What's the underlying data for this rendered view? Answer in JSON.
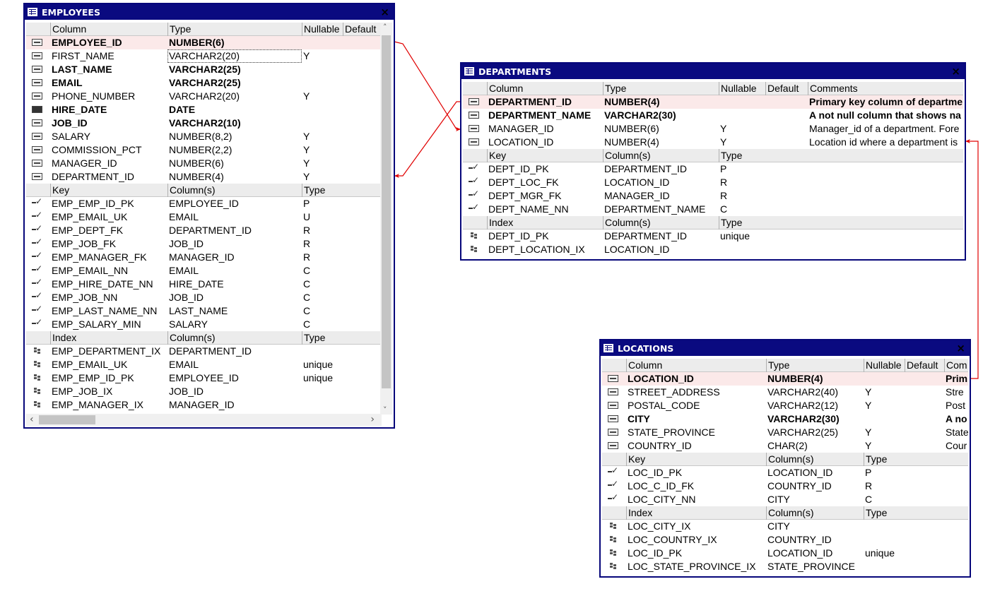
{
  "colors": {
    "title_bar": "#0a0a80",
    "relation_line": "#e00000",
    "pk_row": "#fbe9e9",
    "header_row": "#ececec"
  },
  "tables": [
    {
      "name": "EMPLOYEES",
      "column_headers": [
        "Column",
        "Type",
        "Nullable",
        "Default"
      ],
      "columns": [
        {
          "icon": "number-icon",
          "name": "EMPLOYEE_ID",
          "type": "NUMBER(6)",
          "nullable": "",
          "bold": true,
          "pk": true
        },
        {
          "icon": "text-icon",
          "name": "FIRST_NAME",
          "type": "VARCHAR2(20)",
          "nullable": "Y",
          "bold": false,
          "selected": true
        },
        {
          "icon": "text-icon",
          "name": "LAST_NAME",
          "type": "VARCHAR2(25)",
          "nullable": "",
          "bold": true
        },
        {
          "icon": "text-icon",
          "name": "EMAIL",
          "type": "VARCHAR2(25)",
          "nullable": "",
          "bold": true
        },
        {
          "icon": "text-icon",
          "name": "PHONE_NUMBER",
          "type": "VARCHAR2(20)",
          "nullable": "Y",
          "bold": false
        },
        {
          "icon": "date-icon",
          "name": "HIRE_DATE",
          "type": "DATE",
          "nullable": "",
          "bold": true
        },
        {
          "icon": "text-icon",
          "name": "JOB_ID",
          "type": "VARCHAR2(10)",
          "nullable": "",
          "bold": true
        },
        {
          "icon": "number-icon",
          "name": "SALARY",
          "type": "NUMBER(8,2)",
          "nullable": "Y",
          "bold": false
        },
        {
          "icon": "number-icon",
          "name": "COMMISSION_PCT",
          "type": "NUMBER(2,2)",
          "nullable": "Y",
          "bold": false
        },
        {
          "icon": "number-icon",
          "name": "MANAGER_ID",
          "type": "NUMBER(6)",
          "nullable": "Y",
          "bold": false
        },
        {
          "icon": "number-icon",
          "name": "DEPARTMENT_ID",
          "type": "NUMBER(4)",
          "nullable": "Y",
          "bold": false
        }
      ],
      "key_headers": [
        "Key",
        "Column(s)",
        "Type"
      ],
      "keys": [
        {
          "name": "EMP_EMP_ID_PK",
          "columns": "EMPLOYEE_ID",
          "type": "P"
        },
        {
          "name": "EMP_EMAIL_UK",
          "columns": "EMAIL",
          "type": "U"
        },
        {
          "name": "EMP_DEPT_FK",
          "columns": "DEPARTMENT_ID",
          "type": "R"
        },
        {
          "name": "EMP_JOB_FK",
          "columns": "JOB_ID",
          "type": "R"
        },
        {
          "name": "EMP_MANAGER_FK",
          "columns": "MANAGER_ID",
          "type": "R"
        },
        {
          "name": "EMP_EMAIL_NN",
          "columns": "EMAIL",
          "type": "C"
        },
        {
          "name": "EMP_HIRE_DATE_NN",
          "columns": "HIRE_DATE",
          "type": "C"
        },
        {
          "name": "EMP_JOB_NN",
          "columns": "JOB_ID",
          "type": "C"
        },
        {
          "name": "EMP_LAST_NAME_NN",
          "columns": "LAST_NAME",
          "type": "C"
        },
        {
          "name": "EMP_SALARY_MIN",
          "columns": "SALARY",
          "type": "C"
        }
      ],
      "index_headers": [
        "Index",
        "Column(s)",
        "Type"
      ],
      "indexes": [
        {
          "name": "EMP_DEPARTMENT_IX",
          "columns": "DEPARTMENT_ID",
          "type": ""
        },
        {
          "name": "EMP_EMAIL_UK",
          "columns": "EMAIL",
          "type": "unique"
        },
        {
          "name": "EMP_EMP_ID_PK",
          "columns": "EMPLOYEE_ID",
          "type": "unique"
        },
        {
          "name": "EMP_JOB_IX",
          "columns": "JOB_ID",
          "type": ""
        },
        {
          "name": "EMP_MANAGER_IX",
          "columns": "MANAGER_ID",
          "type": ""
        }
      ]
    },
    {
      "name": "DEPARTMENTS",
      "column_headers": [
        "Column",
        "Type",
        "Nullable",
        "Default",
        "Comments"
      ],
      "columns": [
        {
          "icon": "number-icon",
          "name": "DEPARTMENT_ID",
          "type": "NUMBER(4)",
          "nullable": "",
          "bold": true,
          "pk": true,
          "comment": "Primary key column of departme"
        },
        {
          "icon": "text-icon",
          "name": "DEPARTMENT_NAME",
          "type": "VARCHAR2(30)",
          "nullable": "",
          "bold": true,
          "comment": "A not null column that shows na",
          "icon_selected": true
        },
        {
          "icon": "number-icon",
          "name": "MANAGER_ID",
          "type": "NUMBER(6)",
          "nullable": "Y",
          "bold": false,
          "comment": "Manager_id of a department. Fore"
        },
        {
          "icon": "number-icon",
          "name": "LOCATION_ID",
          "type": "NUMBER(4)",
          "nullable": "Y",
          "bold": false,
          "comment": "Location id where a department is"
        }
      ],
      "key_headers": [
        "Key",
        "Column(s)",
        "Type"
      ],
      "keys": [
        {
          "name": "DEPT_ID_PK",
          "columns": "DEPARTMENT_ID",
          "type": "P"
        },
        {
          "name": "DEPT_LOC_FK",
          "columns": "LOCATION_ID",
          "type": "R"
        },
        {
          "name": "DEPT_MGR_FK",
          "columns": "MANAGER_ID",
          "type": "R"
        },
        {
          "name": "DEPT_NAME_NN",
          "columns": "DEPARTMENT_NAME",
          "type": "C"
        }
      ],
      "index_headers": [
        "Index",
        "Column(s)",
        "Type"
      ],
      "indexes": [
        {
          "name": "DEPT_ID_PK",
          "columns": "DEPARTMENT_ID",
          "type": "unique"
        },
        {
          "name": "DEPT_LOCATION_IX",
          "columns": "LOCATION_ID",
          "type": ""
        }
      ]
    },
    {
      "name": "LOCATIONS",
      "column_headers": [
        "Column",
        "Type",
        "Nullable",
        "Default",
        "Com"
      ],
      "columns": [
        {
          "icon": "number-icon",
          "name": "LOCATION_ID",
          "type": "NUMBER(4)",
          "nullable": "",
          "bold": true,
          "pk": true,
          "comment": "Prim",
          "icon_selected": true
        },
        {
          "icon": "text-icon",
          "name": "STREET_ADDRESS",
          "type": "VARCHAR2(40)",
          "nullable": "Y",
          "bold": false,
          "comment": "Stre"
        },
        {
          "icon": "text-icon",
          "name": "POSTAL_CODE",
          "type": "VARCHAR2(12)",
          "nullable": "Y",
          "bold": false,
          "comment": "Post"
        },
        {
          "icon": "text-icon",
          "name": "CITY",
          "type": "VARCHAR2(30)",
          "nullable": "",
          "bold": true,
          "comment": "A no"
        },
        {
          "icon": "text-icon",
          "name": "STATE_PROVINCE",
          "type": "VARCHAR2(25)",
          "nullable": "Y",
          "bold": false,
          "comment": "State"
        },
        {
          "icon": "text-icon",
          "name": "COUNTRY_ID",
          "type": "CHAR(2)",
          "nullable": "Y",
          "bold": false,
          "comment": "Cour"
        }
      ],
      "key_headers": [
        "Key",
        "Column(s)",
        "Type"
      ],
      "keys": [
        {
          "name": "LOC_ID_PK",
          "columns": "LOCATION_ID",
          "type": "P"
        },
        {
          "name": "LOC_C_ID_FK",
          "columns": "COUNTRY_ID",
          "type": "R"
        },
        {
          "name": "LOC_CITY_NN",
          "columns": "CITY",
          "type": "C"
        }
      ],
      "index_headers": [
        "Index",
        "Column(s)",
        "Type"
      ],
      "indexes": [
        {
          "name": "LOC_CITY_IX",
          "columns": "CITY",
          "type": ""
        },
        {
          "name": "LOC_COUNTRY_IX",
          "columns": "COUNTRY_ID",
          "type": ""
        },
        {
          "name": "LOC_ID_PK",
          "columns": "LOCATION_ID",
          "type": "unique"
        },
        {
          "name": "LOC_STATE_PROVINCE_IX",
          "columns": "STATE_PROVINCE",
          "type": ""
        }
      ]
    }
  ]
}
